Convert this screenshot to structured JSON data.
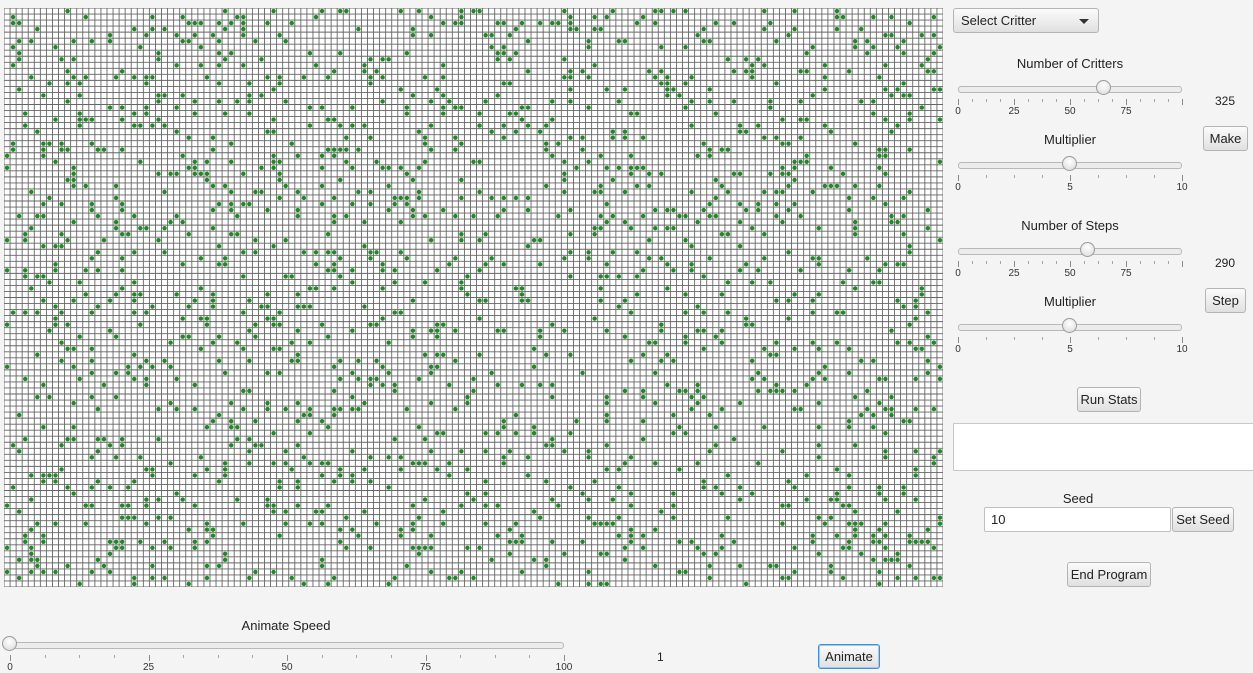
{
  "colors": {
    "grid_line": "#666666",
    "cell_bg": "#ffffff",
    "critter": "#1e8a23",
    "window_bg": "#f4f4f4"
  },
  "world": {
    "columns": 155,
    "rows": 96,
    "critter_count": 1625,
    "critter_icon": "green-dot"
  },
  "controls": {
    "critter_select": {
      "selected": "Select Critter"
    },
    "num_critters": {
      "label": "Number of Critters",
      "slider_value": 65,
      "slider_max": 100,
      "tick_labels": [
        "0",
        "25",
        "50",
        "75"
      ],
      "display": "325"
    },
    "critters_multiplier": {
      "label": "Multiplier",
      "slider_value": 5,
      "slider_max": 10,
      "tick_labels": [
        "0",
        "5",
        "10"
      ]
    },
    "make_button": "Make",
    "num_steps": {
      "label": "Number of Steps",
      "slider_value": 58,
      "slider_max": 100,
      "tick_labels": [
        "0",
        "25",
        "50",
        "75"
      ],
      "display": "290"
    },
    "steps_multiplier": {
      "label": "Multiplier",
      "slider_value": 5,
      "slider_max": 10,
      "tick_labels": [
        "0",
        "5",
        "10"
      ]
    },
    "step_button": "Step",
    "run_stats_button": "Run Stats",
    "stats_output": "",
    "seed": {
      "label": "Seed",
      "value": "10",
      "button": "Set Seed"
    },
    "end_button": "End Program"
  },
  "animate": {
    "label": "Animate Speed",
    "slider_value": 0,
    "slider_max": 100,
    "tick_labels": [
      "0",
      "25",
      "50",
      "75",
      "100"
    ],
    "display": "1",
    "button": "Animate"
  }
}
